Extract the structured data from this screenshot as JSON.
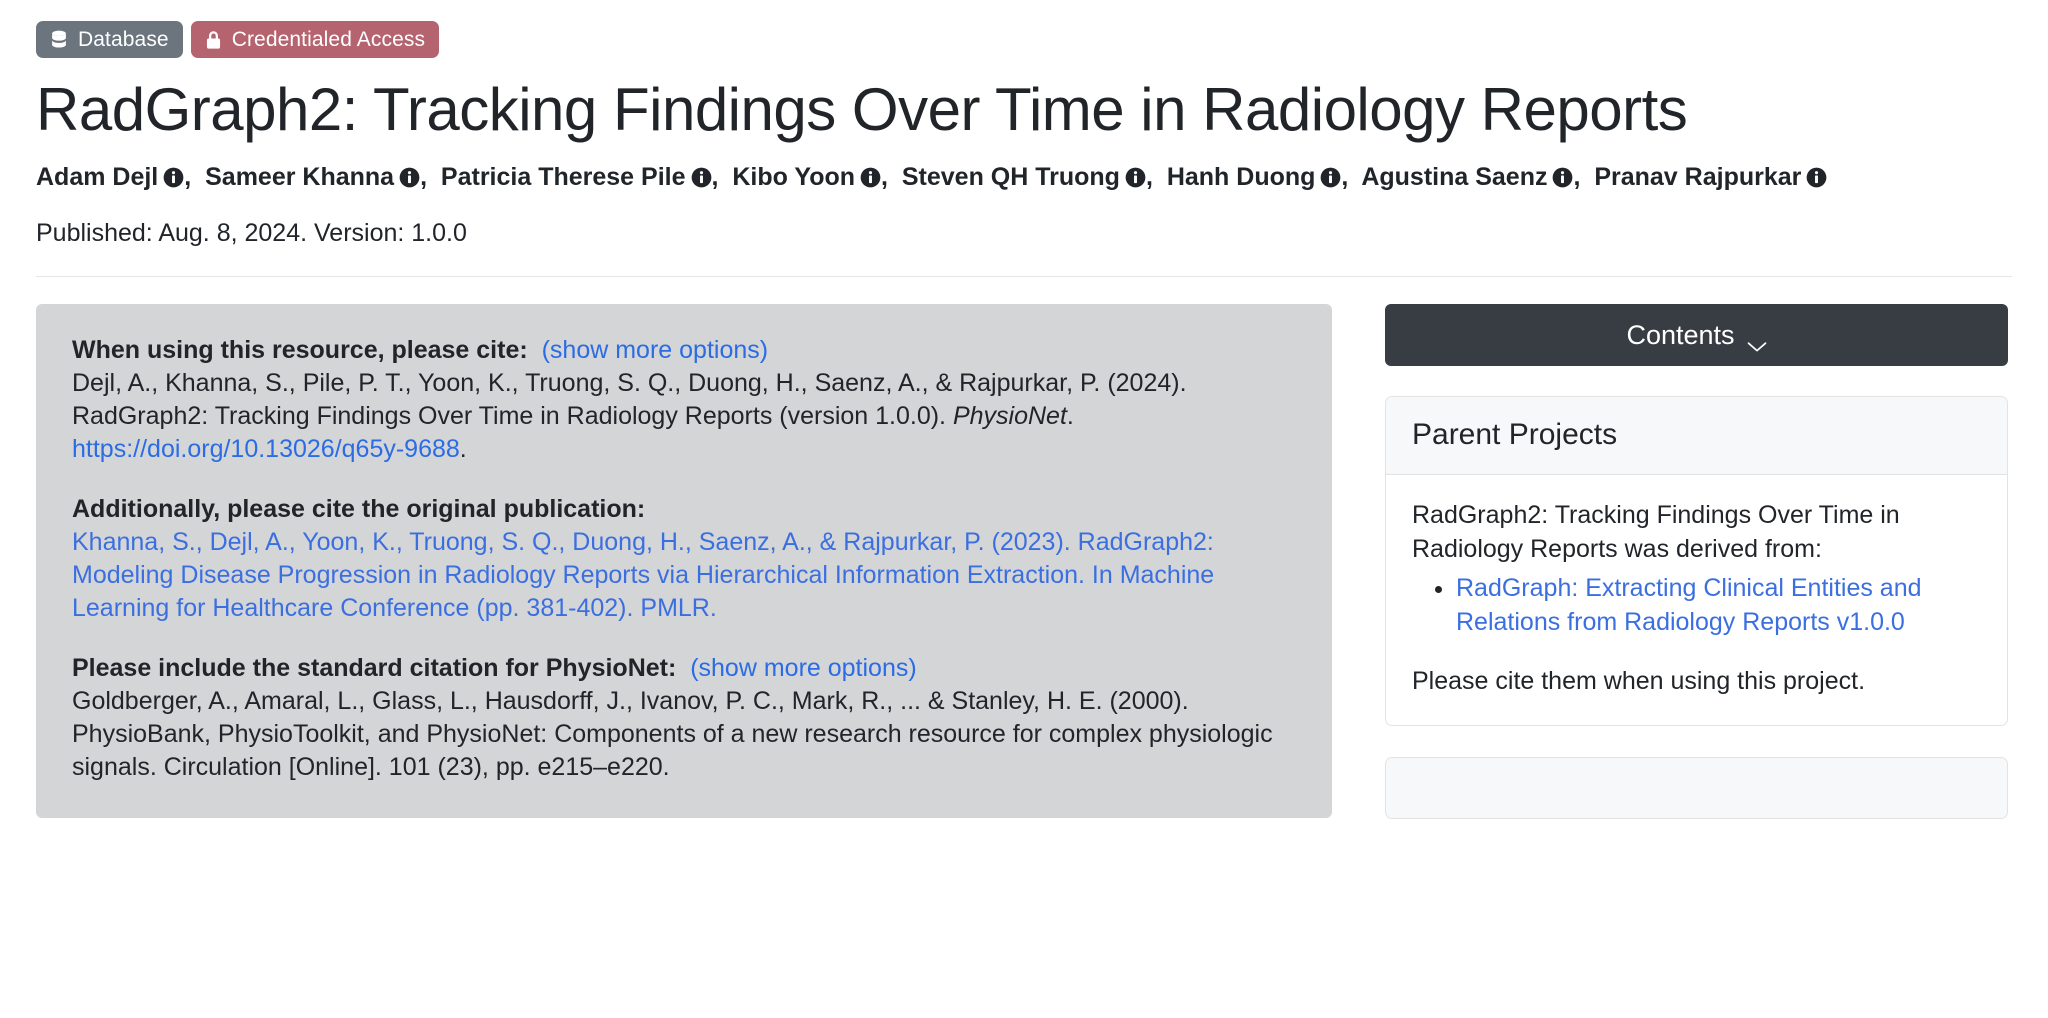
{
  "badges": [
    {
      "label": "Database",
      "icon": "database-icon",
      "color": "#6c757d"
    },
    {
      "label": "Credentialed Access",
      "icon": "lock-icon",
      "color": "#b5636f"
    }
  ],
  "header": {
    "title": "RadGraph2: Tracking Findings Over Time in Radiology Reports",
    "authors": [
      "Adam Dejl",
      "Sameer Khanna",
      "Patricia Therese Pile",
      "Kibo Yoon",
      "Steven QH Truong",
      "Hanh Duong",
      "Agustina Saenz",
      "Pranav Rajpurkar"
    ],
    "author_separator": ",",
    "author_info_icon": "info-icon",
    "published": "Published: Aug. 8, 2024. Version: 1.0.0"
  },
  "citation_card": {
    "blocks": [
      {
        "heading": "When using this resource, please cite:",
        "link_label": "(show more options)",
        "text_1": "Dejl, A., Khanna, S., Pile, P. T., Yoon, K., Truong, S. Q., Duong, H., Saenz, A., & Rajpurkar, P. (2024). RadGraph2: Tracking Findings Over Time in Radiology Reports (version 1.0.0). ",
        "italic_part": "PhysioNet",
        "text_2": ". ",
        "doi": "https://doi.org/10.13026/q65y-9688",
        "text_3": "."
      },
      {
        "heading": "Additionally, please cite the original publication:",
        "link_text": "Khanna, S., Dejl, A., Yoon, K., Truong, S. Q., Duong, H., Saenz, A., & Rajpurkar, P. (2023). RadGraph2: Modeling Disease Progression in Radiology Reports via Hierarchical Information Extraction. In Machine Learning for Healthcare Conference (pp. 381-402). PMLR."
      },
      {
        "heading": "Please include the standard citation for PhysioNet:",
        "link_label": "(show more options)",
        "text": "Goldberger, A., Amaral, L., Glass, L., Hausdorff, J., Ivanov, P. C., Mark, R., ... & Stanley, H. E. (2000). PhysioBank, PhysioToolkit, and PhysioNet: Components of a new research resource for complex physiologic signals. Circulation [Online]. 101 (23), pp. e215–e220."
      }
    ]
  },
  "sidebar": {
    "contents_button": {
      "label": "Contents",
      "icon": "chevron-down-icon"
    },
    "parent_projects": {
      "title": "Parent Projects",
      "intro": "RadGraph2: Tracking Findings Over Time in Radiology Reports was derived from:",
      "items": [
        "RadGraph: Extracting Clinical Entities and Relations from Radiology Reports v1.0.0"
      ],
      "footer": "Please cite them when using this project."
    }
  },
  "colors": {
    "link": "#2b6ce4",
    "card_bg": "#d4d5d7",
    "dark": "#383d44",
    "text": "#212529"
  }
}
